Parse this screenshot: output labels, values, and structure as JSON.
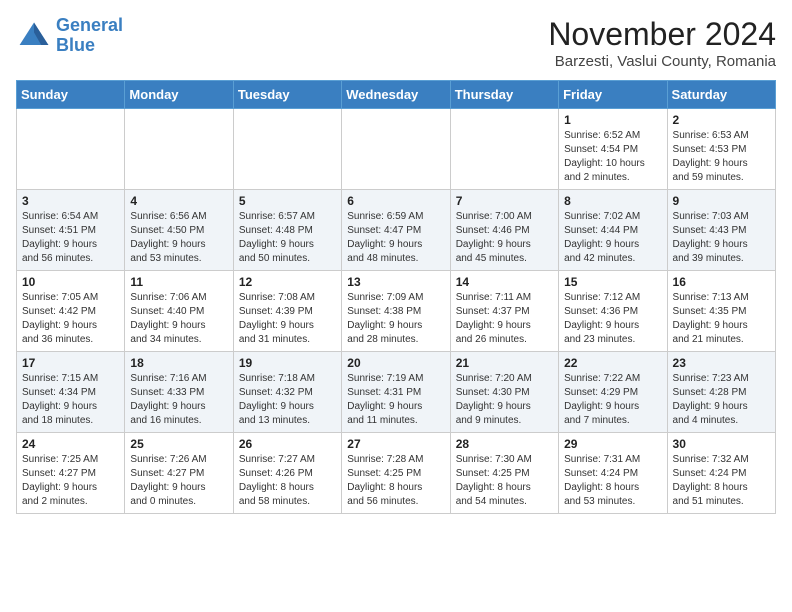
{
  "header": {
    "logo_line1": "General",
    "logo_line2": "Blue",
    "month": "November 2024",
    "location": "Barzesti, Vaslui County, Romania"
  },
  "weekdays": [
    "Sunday",
    "Monday",
    "Tuesday",
    "Wednesday",
    "Thursday",
    "Friday",
    "Saturday"
  ],
  "weeks": [
    [
      {
        "day": "",
        "info": ""
      },
      {
        "day": "",
        "info": ""
      },
      {
        "day": "",
        "info": ""
      },
      {
        "day": "",
        "info": ""
      },
      {
        "day": "",
        "info": ""
      },
      {
        "day": "1",
        "info": "Sunrise: 6:52 AM\nSunset: 4:54 PM\nDaylight: 10 hours\nand 2 minutes."
      },
      {
        "day": "2",
        "info": "Sunrise: 6:53 AM\nSunset: 4:53 PM\nDaylight: 9 hours\nand 59 minutes."
      }
    ],
    [
      {
        "day": "3",
        "info": "Sunrise: 6:54 AM\nSunset: 4:51 PM\nDaylight: 9 hours\nand 56 minutes."
      },
      {
        "day": "4",
        "info": "Sunrise: 6:56 AM\nSunset: 4:50 PM\nDaylight: 9 hours\nand 53 minutes."
      },
      {
        "day": "5",
        "info": "Sunrise: 6:57 AM\nSunset: 4:48 PM\nDaylight: 9 hours\nand 50 minutes."
      },
      {
        "day": "6",
        "info": "Sunrise: 6:59 AM\nSunset: 4:47 PM\nDaylight: 9 hours\nand 48 minutes."
      },
      {
        "day": "7",
        "info": "Sunrise: 7:00 AM\nSunset: 4:46 PM\nDaylight: 9 hours\nand 45 minutes."
      },
      {
        "day": "8",
        "info": "Sunrise: 7:02 AM\nSunset: 4:44 PM\nDaylight: 9 hours\nand 42 minutes."
      },
      {
        "day": "9",
        "info": "Sunrise: 7:03 AM\nSunset: 4:43 PM\nDaylight: 9 hours\nand 39 minutes."
      }
    ],
    [
      {
        "day": "10",
        "info": "Sunrise: 7:05 AM\nSunset: 4:42 PM\nDaylight: 9 hours\nand 36 minutes."
      },
      {
        "day": "11",
        "info": "Sunrise: 7:06 AM\nSunset: 4:40 PM\nDaylight: 9 hours\nand 34 minutes."
      },
      {
        "day": "12",
        "info": "Sunrise: 7:08 AM\nSunset: 4:39 PM\nDaylight: 9 hours\nand 31 minutes."
      },
      {
        "day": "13",
        "info": "Sunrise: 7:09 AM\nSunset: 4:38 PM\nDaylight: 9 hours\nand 28 minutes."
      },
      {
        "day": "14",
        "info": "Sunrise: 7:11 AM\nSunset: 4:37 PM\nDaylight: 9 hours\nand 26 minutes."
      },
      {
        "day": "15",
        "info": "Sunrise: 7:12 AM\nSunset: 4:36 PM\nDaylight: 9 hours\nand 23 minutes."
      },
      {
        "day": "16",
        "info": "Sunrise: 7:13 AM\nSunset: 4:35 PM\nDaylight: 9 hours\nand 21 minutes."
      }
    ],
    [
      {
        "day": "17",
        "info": "Sunrise: 7:15 AM\nSunset: 4:34 PM\nDaylight: 9 hours\nand 18 minutes."
      },
      {
        "day": "18",
        "info": "Sunrise: 7:16 AM\nSunset: 4:33 PM\nDaylight: 9 hours\nand 16 minutes."
      },
      {
        "day": "19",
        "info": "Sunrise: 7:18 AM\nSunset: 4:32 PM\nDaylight: 9 hours\nand 13 minutes."
      },
      {
        "day": "20",
        "info": "Sunrise: 7:19 AM\nSunset: 4:31 PM\nDaylight: 9 hours\nand 11 minutes."
      },
      {
        "day": "21",
        "info": "Sunrise: 7:20 AM\nSunset: 4:30 PM\nDaylight: 9 hours\nand 9 minutes."
      },
      {
        "day": "22",
        "info": "Sunrise: 7:22 AM\nSunset: 4:29 PM\nDaylight: 9 hours\nand 7 minutes."
      },
      {
        "day": "23",
        "info": "Sunrise: 7:23 AM\nSunset: 4:28 PM\nDaylight: 9 hours\nand 4 minutes."
      }
    ],
    [
      {
        "day": "24",
        "info": "Sunrise: 7:25 AM\nSunset: 4:27 PM\nDaylight: 9 hours\nand 2 minutes."
      },
      {
        "day": "25",
        "info": "Sunrise: 7:26 AM\nSunset: 4:27 PM\nDaylight: 9 hours\nand 0 minutes."
      },
      {
        "day": "26",
        "info": "Sunrise: 7:27 AM\nSunset: 4:26 PM\nDaylight: 8 hours\nand 58 minutes."
      },
      {
        "day": "27",
        "info": "Sunrise: 7:28 AM\nSunset: 4:25 PM\nDaylight: 8 hours\nand 56 minutes."
      },
      {
        "day": "28",
        "info": "Sunrise: 7:30 AM\nSunset: 4:25 PM\nDaylight: 8 hours\nand 54 minutes."
      },
      {
        "day": "29",
        "info": "Sunrise: 7:31 AM\nSunset: 4:24 PM\nDaylight: 8 hours\nand 53 minutes."
      },
      {
        "day": "30",
        "info": "Sunrise: 7:32 AM\nSunset: 4:24 PM\nDaylight: 8 hours\nand 51 minutes."
      }
    ]
  ]
}
